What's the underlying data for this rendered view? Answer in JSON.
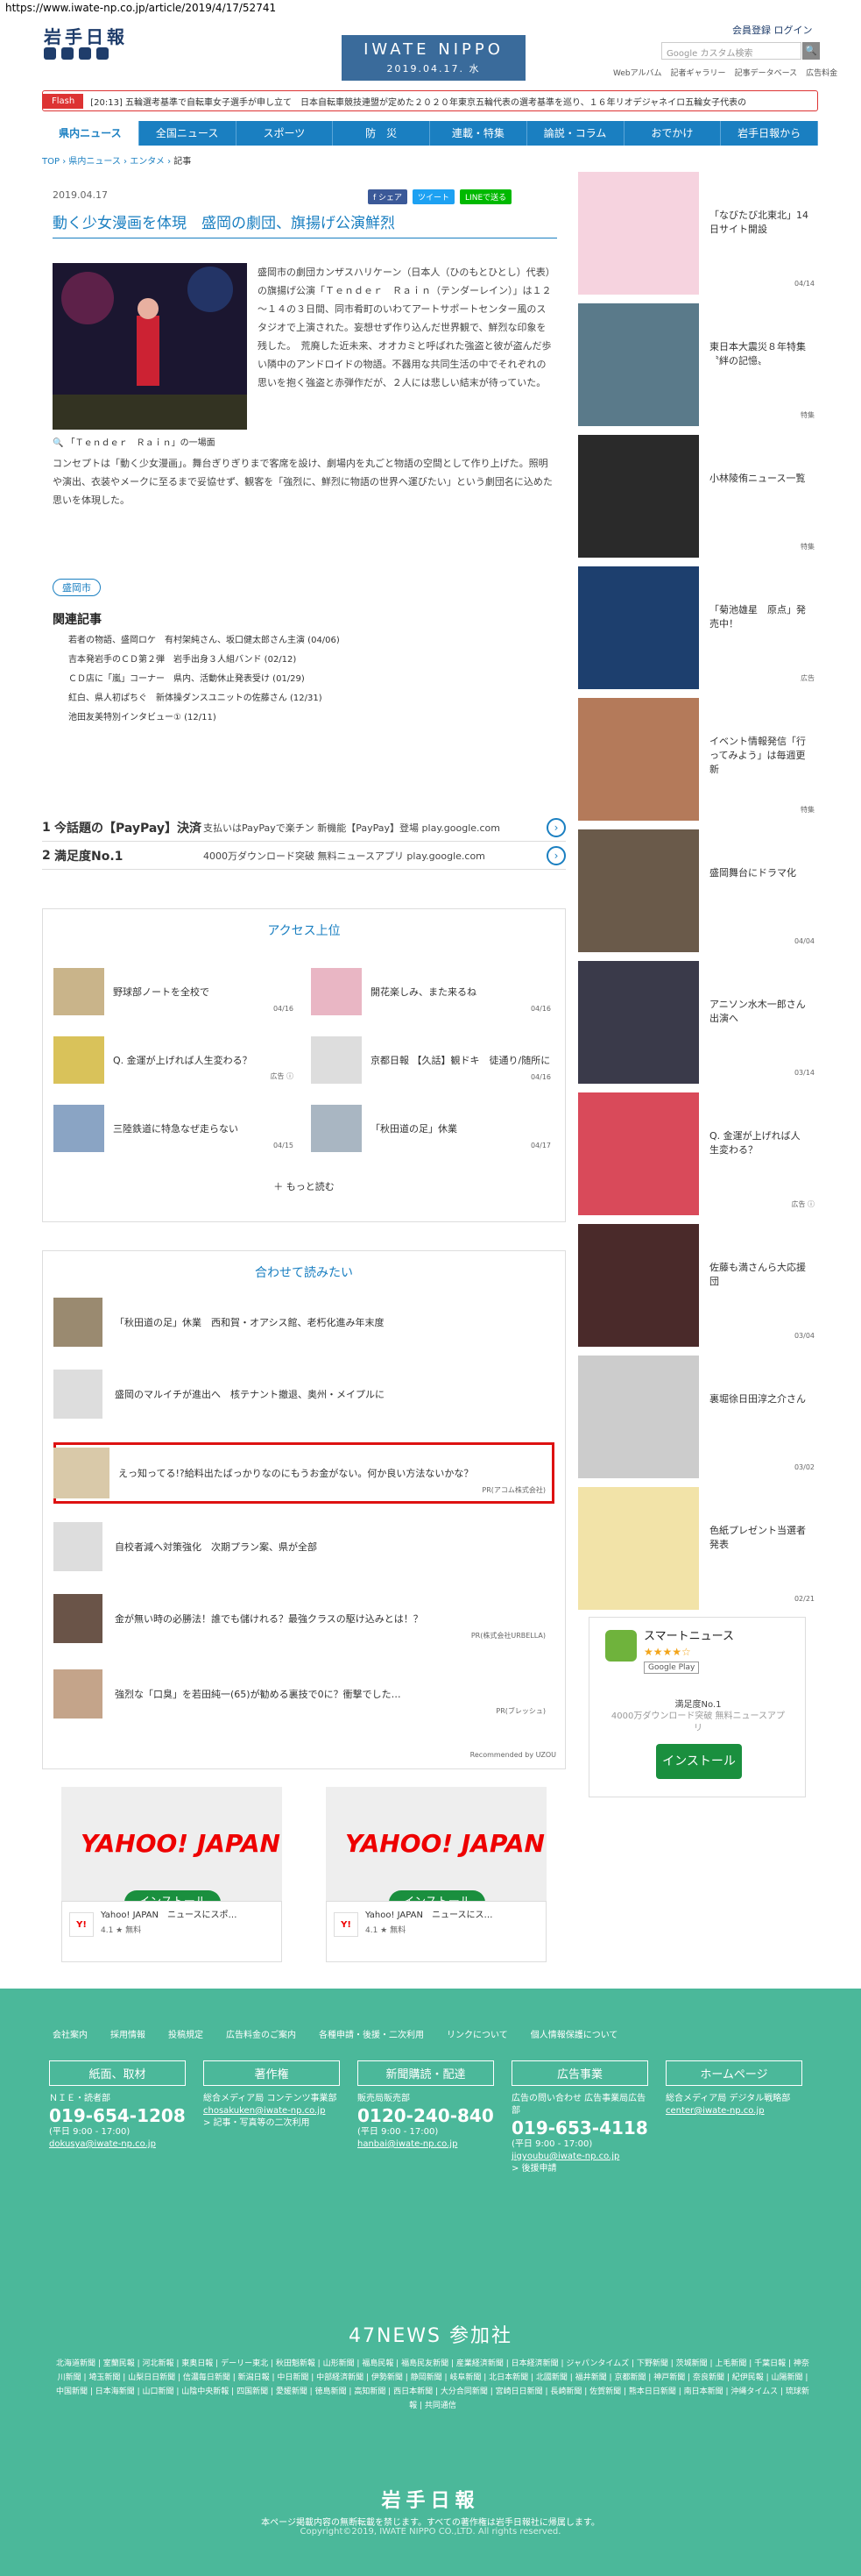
{
  "url": "https://www.iwate-np.co.jp/article/2019/4/17/52741",
  "header": {
    "logo": "岩手日報",
    "brand": "IWATE NIPPO",
    "date": "2019.04.17. 水",
    "member": "会員登録 ログイン",
    "search_placeholder": "Google カスタム検索",
    "search_btn": "🔍",
    "sublinks": [
      "Webアルバム",
      "記者ギャラリー",
      "記事データベース",
      "広告料金"
    ]
  },
  "flash": {
    "label": "Flash",
    "text": "[20:13] 五輪選考基準で自転車女子選手が申し立て　日本自転車競技連盟が定めた２０２０年東京五輪代表の選考基準を巡り、１６年リオデジャネイロ五輪女子代表の"
  },
  "nav": [
    "県内ニュース",
    "全国ニュース",
    "スポーツ",
    "防　災",
    "連載・特集",
    "論説・コラム",
    "おでかけ",
    "岩手日報から"
  ],
  "breadcrumb": [
    "TOP",
    "県内ニュース",
    "エンタメ",
    "記事"
  ],
  "article": {
    "date": "2019.04.17",
    "share": [
      "f シェア",
      "ツイート",
      "LINEで送る"
    ],
    "title": "動く少女漫画を体現　盛岡の劇団、旗揚げ公演鮮烈",
    "caption": "「Ｔｅｎｄｅｒ　Ｒａｉｎ」の一場面",
    "body1": "盛岡市の劇団カンザスハリケーン（日本人（ひのもとひとし）代表）の旗揚げ公演「Ｔｅｎｄｅｒ　Ｒａｉｎ（テンダーレイン）」は１２～１４の３日間、同市肴町のいわてアートサポートセンター風のスタジオで上演された。妄想せず作り込んだ世界観で、鮮烈な印象を残した。　荒廃した近未来、オオカミと呼ばれた強盗と彼が盗んだ歩い隣中のアンドロイドの物語。不器用な共同生活の中でそれぞれの思いを抱く強盗と赤弾作だが、２人には悲しい結末が待っていた。",
    "body2": "コンセプトは「動く少女漫画」。舞台ぎりぎりまで客席を設け、劇場内を丸ごと物語の空間として作り上げた。照明や演出、衣装やメークに至るまで妥協せず、観客を「強烈に、鮮烈に物語の世界へ運びたい」という劇団名に込めた思いを体現した。",
    "tag": "盛岡市",
    "related_head": "関連記事",
    "related": [
      "若者の物語、盛岡ロケ　有村架純さん、坂口健太郎さん主演 (04/06)",
      "吉本発岩手のＣＤ第２弾　岩手出身３人組バンド (02/12)",
      "ＣＤ店に「嵐」コーナー　県内、活動休止発表受け (01/29)",
      "紅白、県人初ぱちぐ　新体操ダンスユニットの佐藤さん (12/31)",
      "池田友美特別インタビュー① (12/11)"
    ]
  },
  "adrows": [
    {
      "num": "1",
      "title": "今話題の【PayPay】決済",
      "desc": "支払いはPayPayで楽チン 新機能【PayPay】登場 play.google.com"
    },
    {
      "num": "2",
      "title": "満足度No.1",
      "desc": "4000万ダウンロード突破 無料ニュースアプリ play.google.com"
    }
  ],
  "access": {
    "heading": "アクセス上位",
    "items": [
      {
        "title": "野球部ノートを全校で",
        "date": "04/16"
      },
      {
        "title": "開花楽しみ、また来るね",
        "date": "04/16"
      },
      {
        "title": "Q. 金運が上げれば人生変わる？",
        "date": "広告 ⓘ"
      },
      {
        "title": "京都日報 【久話】観ドキ　徒通り/随所に",
        "date": "04/16"
      },
      {
        "title": "三陸鉄道に特急なぜ走らない",
        "date": "04/15"
      },
      {
        "title": "「秋田道の足」休業",
        "date": "04/17"
      }
    ],
    "more": "＋ もっと読む"
  },
  "together": {
    "heading": "合わせて読みたい",
    "items": [
      {
        "title": "「秋田道の足」休業　西和賀・オアシス館、老朽化進み年末度",
        "pr": ""
      },
      {
        "title": "盛岡のマルイチが進出へ　核テナント撤退、奥州・メイプルに",
        "pr": ""
      },
      {
        "title": "えっ知ってる!?給料出たばっかりなのにもうお金がない。何か良い方法ないかな？",
        "pr": "PR(アコム株式会社)"
      },
      {
        "title": "自校者減へ対策強化　次期プラン案、県が全部",
        "pr": ""
      },
      {
        "title": "金が無い時の必勝法！誰でも儲けれる？最強クラスの駆け込みとは！？",
        "pr": "PR(株式会社URBELLA)"
      },
      {
        "title": "強烈な「口臭」を若田純一(65)が勧める裏技で0に？衝撃でした…",
        "pr": "PR(ブレッシュ)"
      }
    ],
    "recommended": "Recommended by UZOU"
  },
  "yahoo_ads": [
    {
      "logo": "YAHOO! JAPAN",
      "btn": "インストール",
      "name": "Yahoo! JAPAN　ニュースにスポ…",
      "meta": "4.1 ★ 無料"
    },
    {
      "logo": "YAHOO! JAPAN",
      "btn": "インストール",
      "name": "Yahoo! JAPAN　ニュースにス…",
      "meta": "4.1 ★ 無料"
    }
  ],
  "sidebar": [
    {
      "title": "「なびたび北東北」14日サイト開設",
      "date": "04/14"
    },
    {
      "title": "東日本大震災８年特集〝絆の記憶〟",
      "date": "特集"
    },
    {
      "title": "小林陵侑ニュース一覧",
      "date": "特集"
    },
    {
      "title": "「菊池雄星　原点」発売中！",
      "date": "広告"
    },
    {
      "title": "イベント情報発信「行ってみよう」は毎週更新",
      "date": "特集"
    },
    {
      "title": "盛岡舞台にドラマ化",
      "date": "04/04"
    },
    {
      "title": "アニソン水木一郎さん出演へ",
      "date": "03/14"
    },
    {
      "title": "Q. 金運が上げれば人生変わる？",
      "date": "広告 ⓘ"
    },
    {
      "title": "佐藤も満さんら大応援団",
      "date": "03/04"
    },
    {
      "title": "裏堀徐日田淳之介さん",
      "date": "03/02"
    },
    {
      "title": "色紙プレゼント当選者発表",
      "date": "02/21"
    }
  ],
  "smartnews": {
    "title": "スマートニュース",
    "stars": "★★★★☆",
    "gp": "Google Play",
    "d1": "満足度No.1",
    "d2": "4000万ダウンロード突破 無料ニュースアプリ",
    "install": "インストール"
  },
  "footer": {
    "links": [
      "会社案内",
      "採用情報",
      "投稿規定",
      "広告料金のご案内",
      "各種申請・後援・二次利用",
      "リンクについて",
      "個人情報保護について"
    ],
    "cols": [
      {
        "head": "紙面、取材",
        "l1": "ＮＩＥ・読者部",
        "tel": "019-654-1208",
        "hours": "(平日 9:00 - 17:00)",
        "mail": "dokusya@iwate-np.co.jp",
        "extra": ""
      },
      {
        "head": "著作権",
        "l1": "総合メディア局 コンテンツ事業部",
        "tel": "",
        "hours": "",
        "mail": "chosakuken@iwate-np.co.jp",
        "extra": "> 記事・写真等の二次利用"
      },
      {
        "head": "新聞購読・配達",
        "l1": "販売局販売部",
        "tel": "0120-240-840",
        "hours": "(平日 9:00 - 17:00)",
        "mail": "hanbai@iwate-np.co.jp",
        "extra": ""
      },
      {
        "head": "広告事業",
        "l1": "広告の問い合わせ 広告事業局広告部",
        "tel": "019-653-4118",
        "hours": "(平日 9:00 - 17:00)",
        "mail": "jigyoubu@iwate-np.co.jp",
        "extra": "> 後援申請"
      },
      {
        "head": "ホームページ",
        "l1": "総合メディア局 デジタル戦略部",
        "tel": "",
        "hours": "",
        "mail": "center@iwate-np.co.jp",
        "extra": ""
      }
    ],
    "n47_title": "47NEWS 参加社",
    "n47_list": "北海道新聞 | 室蘭民報 | 河北新報 | 東奥日報 | デーリー東北 | 秋田魁新報 | 山形新聞 | 福島民報 | 福島民友新聞 | 産業経済新聞 | 日本経済新聞 | ジャパンタイムズ | 下野新聞 | 茨城新聞 | 上毛新聞 | 千葉日報 | 神奈川新聞 | 埼玉新聞 | 山梨日日新聞 | 信濃毎日新聞 | 新潟日報 | 中日新聞 | 中部経済新聞 | 伊勢新聞 | 静岡新聞 | 岐阜新聞 | 北日本新聞 | 北國新聞 | 福井新聞 | 京都新聞 | 神戸新聞 | 奈良新聞 | 紀伊民報 | 山陽新聞 | 中国新聞 | 日本海新聞 | 山口新聞 | 山陰中央新報 | 四国新聞 | 愛媛新聞 | 徳島新聞 | 高知新聞 | 西日本新聞 | 大分合同新聞 | 宮崎日日新聞 | 長崎新聞 | 佐賀新聞 | 熊本日日新聞 | 南日本新聞 | 沖縄タイムス | 琉球新報 | 共同通信",
    "logo": "岩手日報",
    "note": "本ページ掲載内容の無断転載を禁じます。すべての著作権は岩手日報社に帰属します。",
    "copy": "Copyright©2019, IWATE NIPPO CO.,LTD. All rights reserved."
  }
}
